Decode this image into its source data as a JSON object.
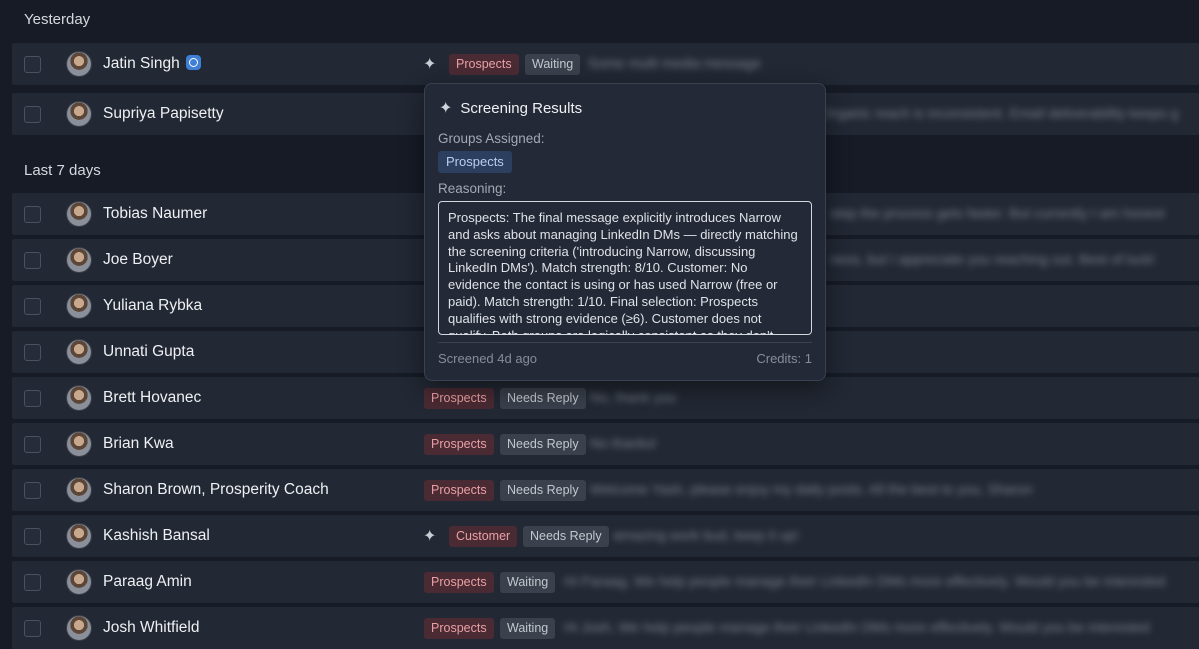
{
  "sections": {
    "yesterday": "Yesterday",
    "last7": "Last 7 days"
  },
  "rows": [
    {
      "name": "Jatin Singh",
      "group": "Prospects",
      "status": "Waiting",
      "preview": "Some multi media message"
    },
    {
      "name": "Supriya Papisetty",
      "preview": "Organic reach is inconsistent. Email deliverability keeps g"
    },
    {
      "name": "Tobias Naumer",
      "preview": "step the process gets faster. But currently I am honest"
    },
    {
      "name": "Joe Boyer",
      "preview": "ness, but I appreciate you reaching out. Best of luck!"
    },
    {
      "name": "Yuliana Rybka"
    },
    {
      "name": "Unnati Gupta"
    },
    {
      "name": "Brett Hovanec",
      "group": "Prospects",
      "status": "Needs Reply",
      "preview": "No, thank you"
    },
    {
      "name": "Brian Kwa",
      "group": "Prospects",
      "status": "Needs Reply",
      "preview": "No thanks!"
    },
    {
      "name": "Sharon Brown, Prosperity Coach",
      "group": "Prospects",
      "status": "Needs Reply",
      "preview": "Welcome Yash, please enjoy my daily posts. All the best to you, Sharon"
    },
    {
      "name": "Kashish Bansal",
      "group": "Customer",
      "status": "Needs Reply",
      "preview": "amazing work bud, keep it up!"
    },
    {
      "name": "Paraag Amin",
      "group": "Prospects",
      "status": "Waiting",
      "preview": "Hi Paraag, We help people manage their LinkedIn DMs more effectively. Would you be interested"
    },
    {
      "name": "Josh Whitfield",
      "group": "Prospects",
      "status": "Waiting",
      "preview": "Hi Josh, We help people manage their LinkedIn DMs more effectively. Would you be interested"
    }
  ],
  "popover": {
    "title": "Screening Results",
    "groups_label": "Groups Assigned:",
    "group_chip": "Prospects",
    "reasoning_label": "Reasoning:",
    "reasoning": "Prospects: The final message explicitly introduces Narrow and asks about managing LinkedIn DMs — directly matching the screening criteria ('introducing Narrow, discussing LinkedIn DMs'). Match strength: 8/10. Customer: No evidence the contact is using or has used Narrow (free or paid). Match strength: 1/10. Final selection: Prospects qualifies with strong evidence (≥6). Customer does not qualify. Both groups are logically consistent as they don't",
    "screened": "Screened 4d ago",
    "credits": "Credits: 1"
  },
  "icons": {
    "sparkle": "sparkle-icon",
    "verified": "verified-badge-icon"
  },
  "colors": {
    "background": "#161b26",
    "row": "#222834",
    "group_tag": "#4a2a33",
    "group_chip": "#2d3f5e"
  }
}
